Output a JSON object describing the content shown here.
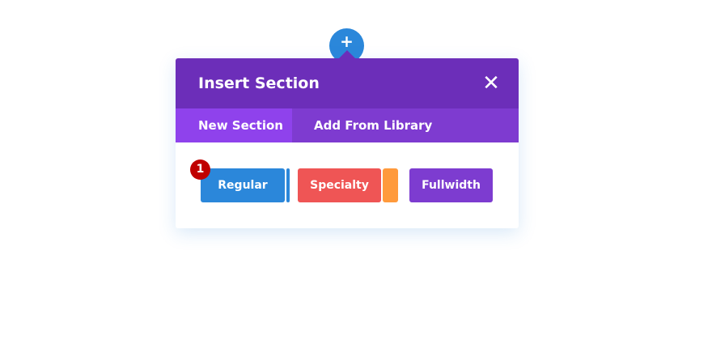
{
  "add_button": {
    "icon": "plus-icon",
    "glyph": "+"
  },
  "modal": {
    "title": "Insert Section",
    "close_glyph": "✕",
    "tabs": [
      {
        "label": "New Section",
        "active": true
      },
      {
        "label": "Add From Library",
        "active": false
      }
    ],
    "section_types": [
      {
        "label": "Regular",
        "color": "#2b87da"
      },
      {
        "label": "Specialty",
        "color": "#ef5555",
        "accent_color": "#ff9a3c"
      },
      {
        "label": "Fullwidth",
        "color": "#7d3cd0"
      }
    ],
    "step_badge": "1"
  },
  "colors": {
    "header": "#6c2eb9",
    "tabs_bar": "#7e3bd0",
    "active_tab": "#8f42ec",
    "add_button": "#2b87da",
    "badge": "#c00000"
  }
}
